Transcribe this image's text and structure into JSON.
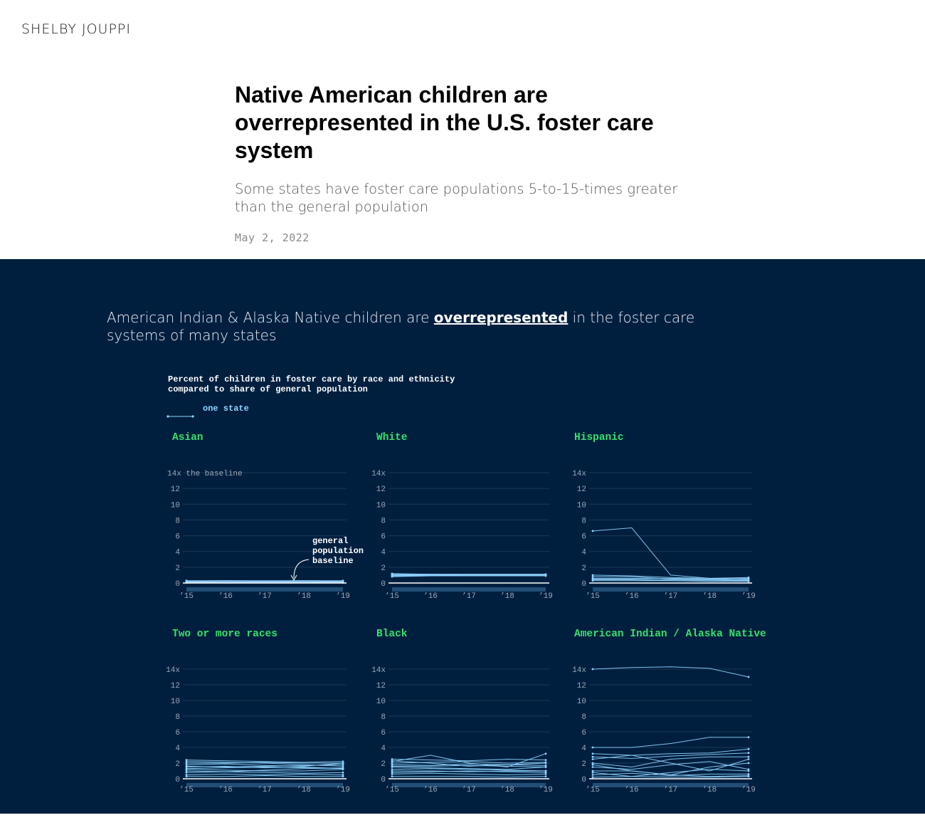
{
  "site": {
    "name": "SHELBY JOUPPI"
  },
  "article": {
    "title": "Native American children are overrepresented in the U.S. foster care system",
    "subtitle": "Some states have foster care populations 5-to-15-times greater than the general population",
    "date": "May 2, 2022"
  },
  "lede": {
    "before": "American Indian & Alaska Native children are ",
    "emphasis": "overrepresented",
    "after": " in the foster care systems of many states"
  },
  "colors": {
    "background": "#001f3f",
    "panel_title": "#36e06a",
    "line": "#8fd4ff",
    "baseline": "#ffffff",
    "grid": "#1c3856",
    "tick": "#9aa7b6"
  },
  "chart_data": {
    "type": "line",
    "title": "Percent of children in foster care by race and ethnicity",
    "subtitle": "compared to share of general population",
    "legend": {
      "label": "one state"
    },
    "x": [
      "’15",
      "’16",
      "’17",
      "’18",
      "’19"
    ],
    "y_ticks": [
      0,
      2,
      4,
      6,
      8,
      10,
      12,
      14
    ],
    "y_top_label_first": "14x the baseline",
    "y_top_label": "14x",
    "ylim": [
      0,
      14
    ],
    "annotation": {
      "text": [
        "general",
        "population",
        "baseline"
      ],
      "panel": "Asian",
      "y": 1
    },
    "panels": [
      {
        "name": "Asian",
        "series": [
          [
            0.1,
            0.1,
            0.1,
            0.1,
            0.1
          ],
          [
            0.2,
            0.2,
            0.2,
            0.2,
            0.2
          ],
          [
            0.3,
            0.3,
            0.3,
            0.3,
            0.3
          ],
          [
            0.15,
            0.2,
            0.2,
            0.2,
            0.15
          ],
          [
            0.25,
            0.3,
            0.25,
            0.3,
            0.25
          ],
          [
            0.05,
            0.05,
            0.1,
            0.1,
            0.05
          ]
        ]
      },
      {
        "name": "White",
        "series": [
          [
            0.9,
            1.0,
            1.0,
            1.0,
            1.0
          ],
          [
            1.1,
            1.1,
            1.1,
            1.1,
            1.1
          ],
          [
            1.0,
            1.0,
            1.0,
            1.0,
            1.0
          ],
          [
            0.8,
            0.9,
            0.9,
            0.9,
            0.9
          ],
          [
            1.2,
            1.1,
            1.1,
            1.1,
            1.1
          ],
          [
            0.9,
            0.9,
            1.0,
            1.0,
            1.0
          ],
          [
            1.0,
            1.1,
            1.0,
            1.0,
            1.0
          ]
        ]
      },
      {
        "name": "Hispanic",
        "series": [
          [
            6.6,
            7.0,
            1.0,
            0.6,
            0.5
          ],
          [
            1.0,
            0.9,
            0.7,
            0.6,
            0.7
          ],
          [
            0.8,
            0.8,
            0.5,
            0.5,
            0.6
          ],
          [
            0.6,
            0.6,
            0.6,
            0.5,
            0.4
          ],
          [
            0.5,
            0.5,
            0.4,
            0.4,
            0.3
          ],
          [
            0.4,
            0.4,
            0.3,
            0.3,
            0.3
          ],
          [
            0.3,
            0.3,
            0.3,
            0.2,
            0.2
          ]
        ]
      },
      {
        "name": "Two or more races",
        "series": [
          [
            2.0,
            2.0,
            2.1,
            2.0,
            2.0
          ],
          [
            1.8,
            1.9,
            1.7,
            1.6,
            2.0
          ],
          [
            1.5,
            1.6,
            1.4,
            1.5,
            1.3
          ],
          [
            1.2,
            1.1,
            1.0,
            1.0,
            1.2
          ],
          [
            2.2,
            2.1,
            2.0,
            1.8,
            1.6
          ],
          [
            1.0,
            0.9,
            1.1,
            1.3,
            1.4
          ],
          [
            0.8,
            0.9,
            0.8,
            0.7,
            0.8
          ],
          [
            0.5,
            0.6,
            0.5,
            0.6,
            0.5
          ],
          [
            1.6,
            1.5,
            1.6,
            1.7,
            1.8
          ],
          [
            0.3,
            0.3,
            0.4,
            0.3,
            0.3
          ],
          [
            2.4,
            2.3,
            2.2,
            2.1,
            2.2
          ],
          [
            1.3,
            1.4,
            1.5,
            1.4,
            1.3
          ]
        ]
      },
      {
        "name": "Black",
        "series": [
          [
            2.2,
            3.0,
            2.0,
            1.5,
            3.2
          ],
          [
            2.0,
            2.1,
            2.2,
            2.0,
            2.1
          ],
          [
            1.8,
            1.7,
            1.9,
            1.8,
            1.7
          ],
          [
            1.5,
            1.4,
            1.3,
            1.2,
            1.5
          ],
          [
            1.2,
            1.3,
            1.2,
            1.1,
            1.0
          ],
          [
            1.0,
            1.0,
            0.9,
            1.0,
            1.0
          ],
          [
            0.6,
            0.7,
            0.6,
            0.5,
            0.6
          ],
          [
            2.5,
            2.4,
            2.3,
            2.5,
            2.4
          ],
          [
            2.3,
            2.0,
            1.6,
            1.8,
            2.0
          ],
          [
            0.8,
            0.9,
            1.0,
            0.9,
            0.8
          ],
          [
            1.6,
            1.6,
            1.7,
            1.6,
            1.5
          ],
          [
            0.3,
            0.3,
            0.3,
            0.2,
            0.3
          ]
        ]
      },
      {
        "name": "American Indian / Alaska Native",
        "series": [
          [
            14.0,
            14.2,
            14.3,
            14.1,
            13.0
          ],
          [
            4.0,
            4.0,
            4.5,
            5.3,
            5.3
          ],
          [
            3.2,
            3.0,
            3.2,
            3.3,
            3.8
          ],
          [
            2.8,
            2.6,
            2.9,
            3.1,
            3.3
          ],
          [
            2.5,
            3.0,
            2.0,
            1.0,
            2.5
          ],
          [
            2.0,
            1.5,
            2.5,
            2.8,
            2.8
          ],
          [
            1.5,
            1.2,
            1.8,
            2.2,
            1.2
          ],
          [
            1.0,
            1.0,
            0.5,
            1.5,
            2.0
          ],
          [
            0.5,
            0.7,
            0.4,
            0.6,
            0.6
          ],
          [
            1.8,
            1.0,
            0.5,
            0.3,
            0.4
          ],
          [
            0.8,
            0.3,
            0.8,
            1.2,
            1.0
          ],
          [
            0.2,
            0.3,
            0.2,
            0.2,
            0.3
          ]
        ]
      }
    ]
  }
}
